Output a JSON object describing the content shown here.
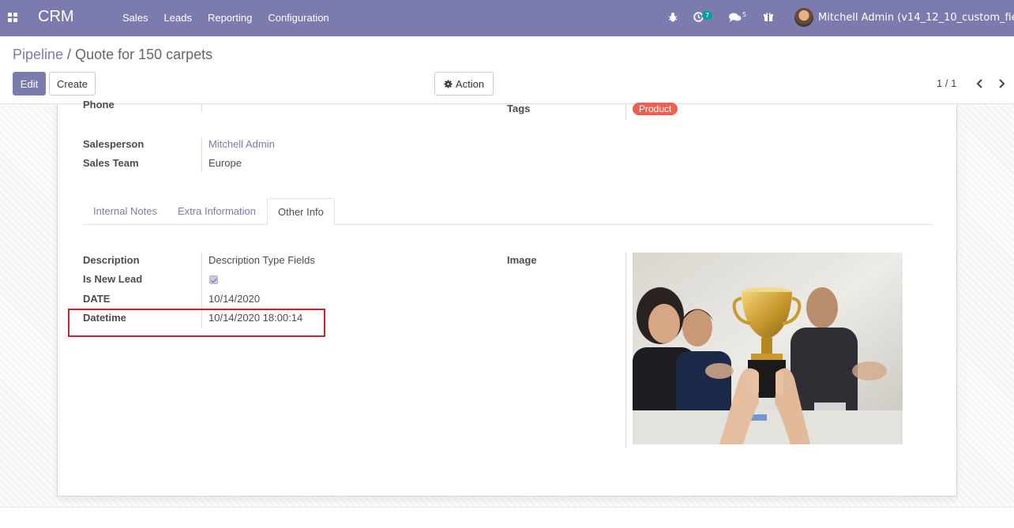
{
  "navbar": {
    "brand": "CRM",
    "menu": [
      "Sales",
      "Leads",
      "Reporting",
      "Configuration"
    ],
    "activity_count": "7",
    "messages_count": "5",
    "user": "Mitchell Admin (v14_12_10_custom_fields)"
  },
  "breadcrumb": {
    "parent": "Pipeline",
    "separator": "/",
    "current": "Quote for 150 carpets"
  },
  "buttons": {
    "edit": "Edit",
    "create": "Create",
    "action": "Action"
  },
  "pager": {
    "value": "1 / 1"
  },
  "form": {
    "phone_label": "Phone",
    "tags_label": "Tags",
    "tag_value": "Product",
    "salesperson_label": "Salesperson",
    "salesperson_value": "Mitchell Admin",
    "sales_team_label": "Sales Team",
    "sales_team_value": "Europe",
    "tabs": [
      "Internal Notes",
      "Extra Information",
      "Other Info"
    ],
    "active_tab": "Other Info",
    "description_label": "Description",
    "description_value": "Description Type Fields",
    "is_new_lead_label": "Is New Lead",
    "is_new_lead_checked": true,
    "date_label": "DATE",
    "date_value": "10/14/2020",
    "datetime_label": "Datetime",
    "datetime_value": "10/14/2020 18:00:14",
    "image_label": "Image"
  },
  "colors": {
    "navbar": "#7c7bad",
    "tag": "#f06050",
    "highlight": "#d0202c"
  }
}
